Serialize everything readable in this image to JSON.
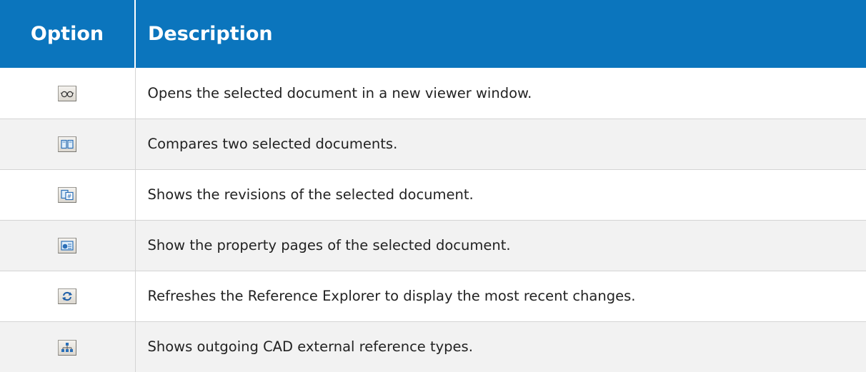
{
  "header": {
    "option": "Option",
    "description": "Description"
  },
  "rows": [
    {
      "icon": "glasses-icon",
      "description": "Opens the selected document in a new viewer window."
    },
    {
      "icon": "compare-documents-icon",
      "description": "Compares two selected documents."
    },
    {
      "icon": "revisions-icon",
      "description": "Shows the revisions of the selected document."
    },
    {
      "icon": "properties-icon",
      "description": "Show the property pages of the selected document."
    },
    {
      "icon": "refresh-icon",
      "description": "Refreshes the Reference Explorer to display the most recent changes."
    },
    {
      "icon": "cad-references-icon",
      "description": "Shows outgoing CAD external reference types."
    }
  ],
  "colors": {
    "header_bg": "#0b75bd",
    "header_text": "#ffffff",
    "alt_row_bg": "#f2f2f2",
    "icon_blue": "#2a6fb8"
  }
}
